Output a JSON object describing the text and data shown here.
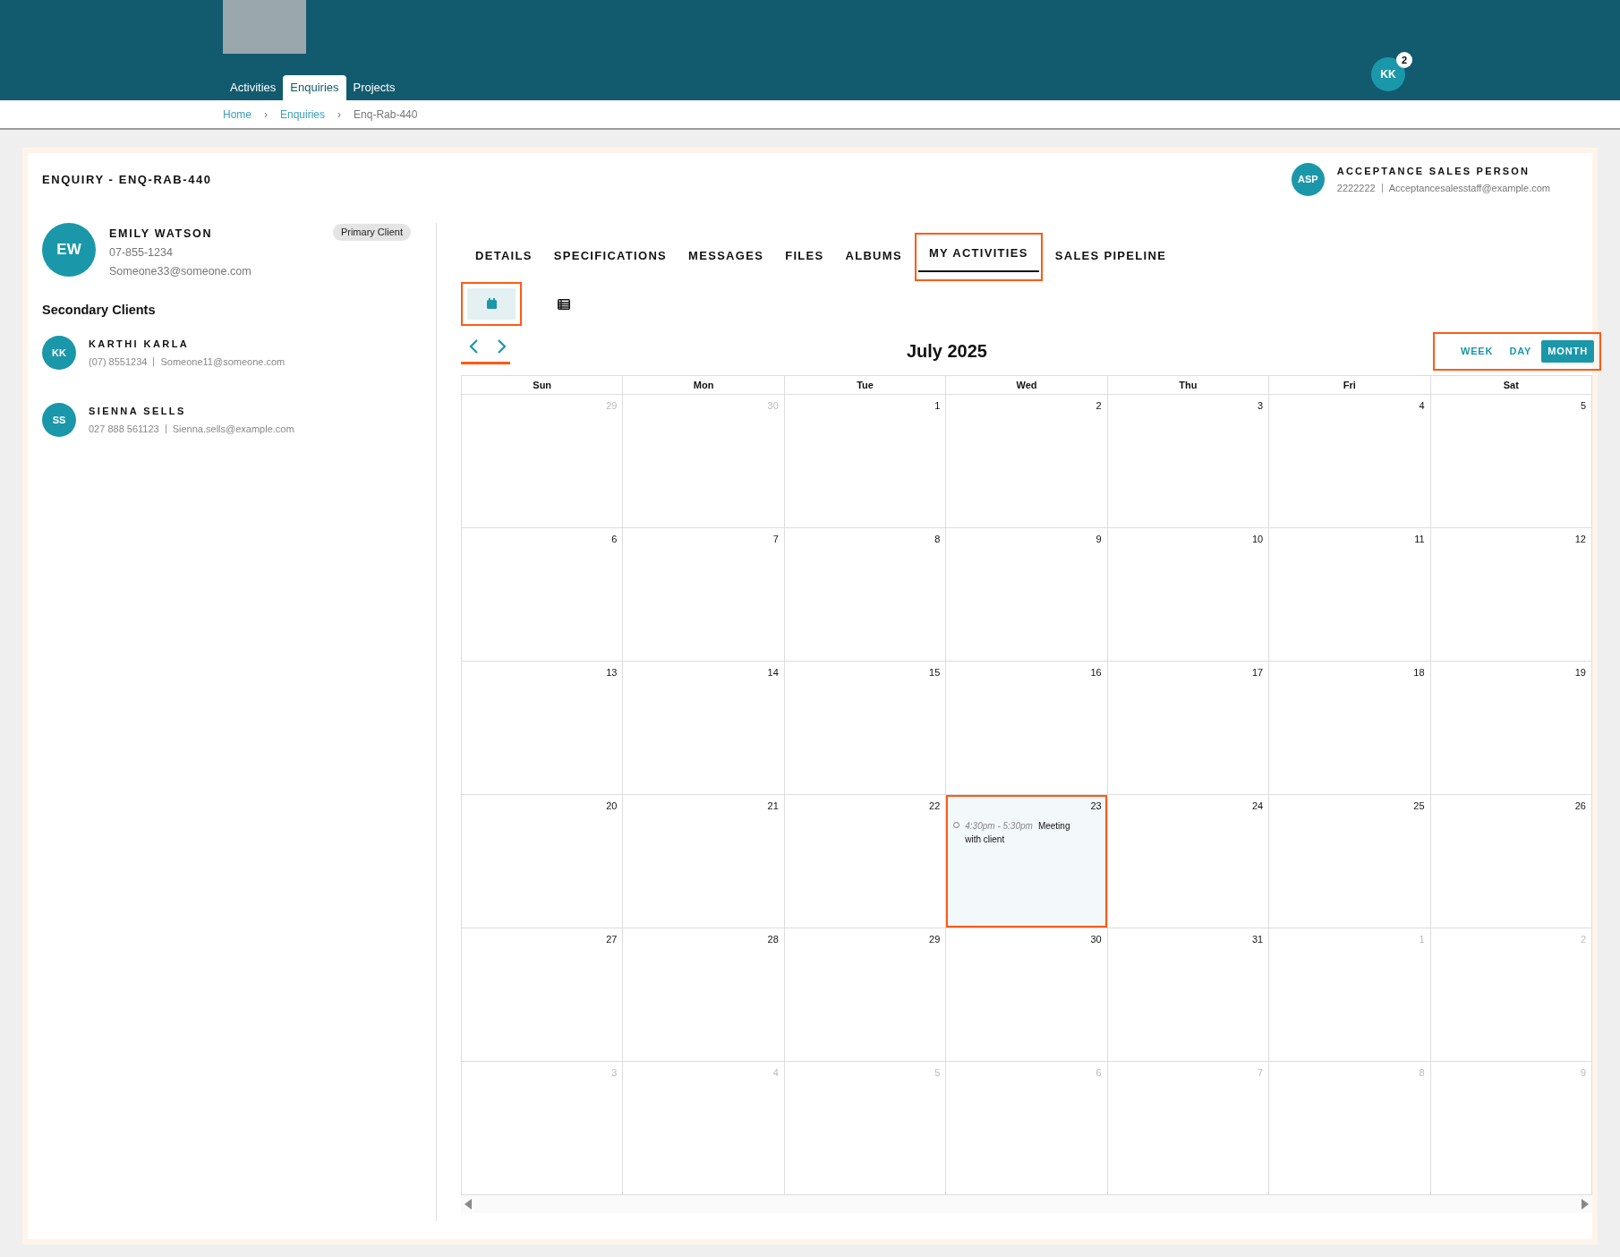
{
  "header": {
    "nav": [
      {
        "label": "Activities",
        "selected": false
      },
      {
        "label": "Enquiries",
        "selected": true
      },
      {
        "label": "Projects",
        "selected": false
      }
    ],
    "user": {
      "initials": "KK",
      "badge": "2"
    }
  },
  "breadcrumbs": [
    {
      "label": "Home",
      "current": false
    },
    {
      "label": "Enquiries",
      "current": false
    },
    {
      "label": "Enq-Rab-440",
      "current": true
    }
  ],
  "breadcrumb_separator": "›",
  "enquiry_title": "ENQUIRY - ENQ-RAB-440",
  "sales_person": {
    "initials": "ASP",
    "name": "ACCEPTANCE SALES PERSON",
    "phone": "2222222",
    "email": "Acceptancesalesstaff@example.com"
  },
  "primary_client": {
    "initials": "EW",
    "name": "EMILY WATSON",
    "phone": "07-855-1234",
    "email": "Someone33@someone.com",
    "badge": "Primary Client"
  },
  "secondary_heading": "Secondary Clients",
  "secondary_clients": [
    {
      "initials": "KK",
      "name": "KARTHI KARLA",
      "phone": "(07) 8551234",
      "email": "Someone11@someone.com"
    },
    {
      "initials": "SS",
      "name": "SIENNA SELLS",
      "phone": "027 888 561123",
      "email": "Sienna.sells@example.com"
    }
  ],
  "tabs": [
    {
      "label": "DETAILS",
      "selected": false
    },
    {
      "label": "SPECIFICATIONS",
      "selected": false
    },
    {
      "label": "MESSAGES",
      "selected": false
    },
    {
      "label": "FILES",
      "selected": false
    },
    {
      "label": "ALBUMS",
      "selected": false
    },
    {
      "label": "MY ACTIVITIES",
      "selected": true
    },
    {
      "label": "SALES PIPELINE",
      "selected": false
    }
  ],
  "view_toggle": [
    {
      "kind": "calendar",
      "selected": true
    },
    {
      "kind": "list",
      "selected": false
    }
  ],
  "calendar": {
    "title": "July 2025",
    "ranges": [
      {
        "label": "WEEK",
        "selected": false
      },
      {
        "label": "DAY",
        "selected": false
      },
      {
        "label": "MONTH",
        "selected": true
      }
    ],
    "weekdays": [
      "Sun",
      "Mon",
      "Tue",
      "Wed",
      "Thu",
      "Fri",
      "Sat"
    ],
    "weeks": [
      [
        {
          "day": "29",
          "muted": true,
          "selected": false
        },
        {
          "day": "30",
          "muted": true,
          "selected": false
        },
        {
          "day": "1",
          "muted": false,
          "selected": false
        },
        {
          "day": "2",
          "muted": false,
          "selected": false
        },
        {
          "day": "3",
          "muted": false,
          "selected": false
        },
        {
          "day": "4",
          "muted": false,
          "selected": false
        },
        {
          "day": "5",
          "muted": false,
          "selected": false
        }
      ],
      [
        {
          "day": "6",
          "muted": false,
          "selected": false
        },
        {
          "day": "7",
          "muted": false,
          "selected": false
        },
        {
          "day": "8",
          "muted": false,
          "selected": false
        },
        {
          "day": "9",
          "muted": false,
          "selected": false
        },
        {
          "day": "10",
          "muted": false,
          "selected": false
        },
        {
          "day": "11",
          "muted": false,
          "selected": false
        },
        {
          "day": "12",
          "muted": false,
          "selected": false
        }
      ],
      [
        {
          "day": "13",
          "muted": false,
          "selected": false
        },
        {
          "day": "14",
          "muted": false,
          "selected": false
        },
        {
          "day": "15",
          "muted": false,
          "selected": false
        },
        {
          "day": "16",
          "muted": false,
          "selected": false
        },
        {
          "day": "17",
          "muted": false,
          "selected": false
        },
        {
          "day": "18",
          "muted": false,
          "selected": false
        },
        {
          "day": "19",
          "muted": false,
          "selected": false
        }
      ],
      [
        {
          "day": "20",
          "muted": false,
          "selected": false
        },
        {
          "day": "21",
          "muted": false,
          "selected": false
        },
        {
          "day": "22",
          "muted": false,
          "selected": false
        },
        {
          "day": "23",
          "muted": false,
          "selected": true,
          "events": [
            {
              "time": "4:30pm - 5:30pm",
              "title": "Meeting with client"
            }
          ]
        },
        {
          "day": "24",
          "muted": false,
          "selected": false
        },
        {
          "day": "25",
          "muted": false,
          "selected": false
        },
        {
          "day": "26",
          "muted": false,
          "selected": false
        }
      ],
      [
        {
          "day": "27",
          "muted": false,
          "selected": false
        },
        {
          "day": "28",
          "muted": false,
          "selected": false
        },
        {
          "day": "29",
          "muted": false,
          "selected": false
        },
        {
          "day": "30",
          "muted": false,
          "selected": false
        },
        {
          "day": "31",
          "muted": false,
          "selected": false
        },
        {
          "day": "1",
          "muted": true,
          "selected": false
        },
        {
          "day": "2",
          "muted": true,
          "selected": false
        }
      ],
      [
        {
          "day": "3",
          "muted": true,
          "selected": false
        },
        {
          "day": "4",
          "muted": true,
          "selected": false
        },
        {
          "day": "5",
          "muted": true,
          "selected": false
        },
        {
          "day": "6",
          "muted": true,
          "selected": false
        },
        {
          "day": "7",
          "muted": true,
          "selected": false
        },
        {
          "day": "8",
          "muted": true,
          "selected": false
        },
        {
          "day": "9",
          "muted": true,
          "selected": false
        }
      ]
    ]
  }
}
